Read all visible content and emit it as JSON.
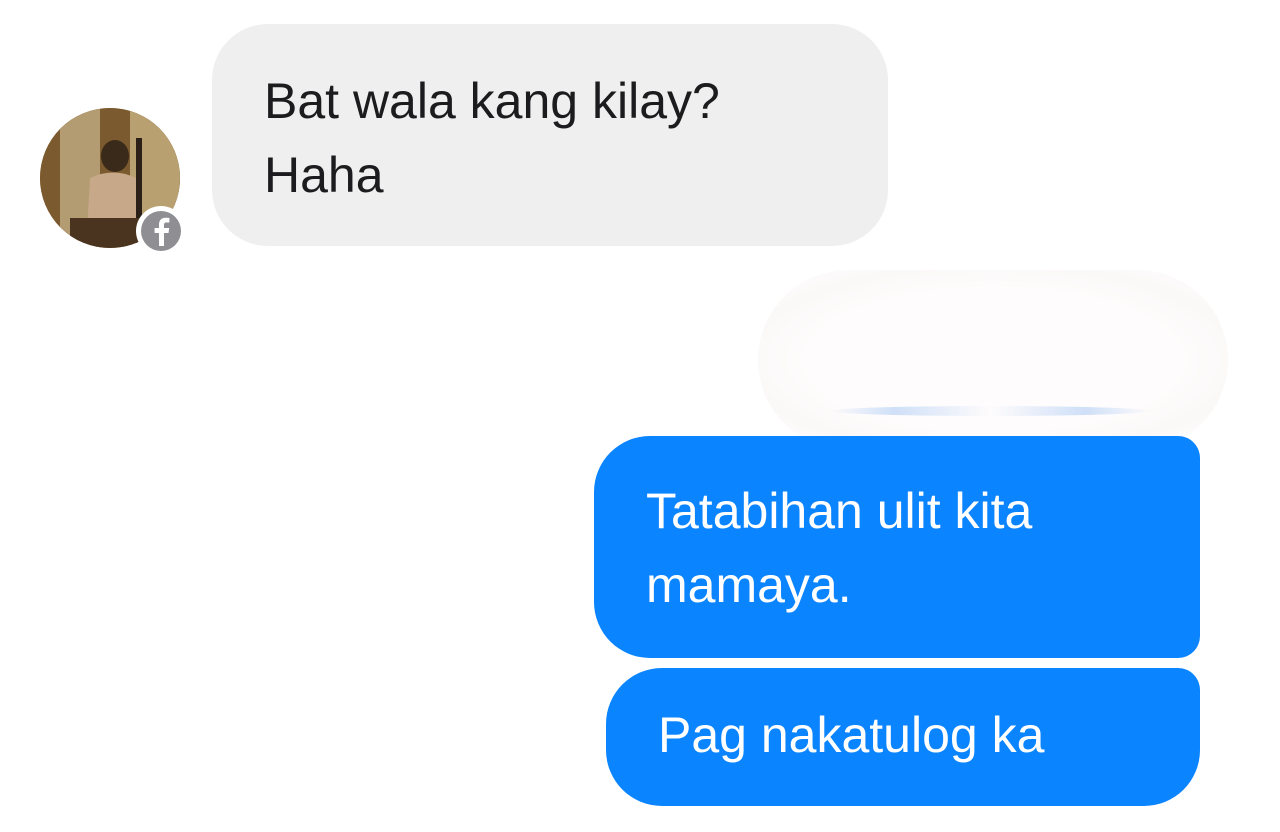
{
  "messages": {
    "incoming": {
      "lines": [
        "Bat wala kang kilay?",
        "Haha"
      ]
    },
    "outgoing_1": {
      "lines": [
        "Tatabihan ulit kita",
        "mamaya."
      ]
    },
    "outgoing_2": {
      "text": "Pag nakatulog ka"
    }
  },
  "icons": {
    "avatar": "profile-photo",
    "badge": "facebook-icon"
  },
  "colors": {
    "incoming_bubble": "#efefef",
    "outgoing_bubble": "#0a84ff",
    "badge": "#8e8e93"
  }
}
